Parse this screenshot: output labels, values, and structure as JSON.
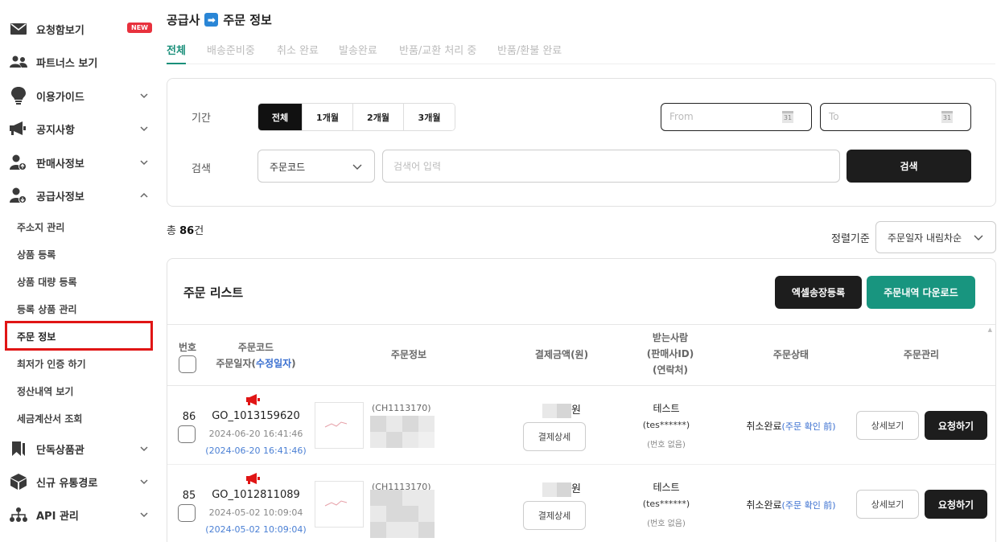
{
  "sidebar": {
    "items": [
      {
        "label": "요청함보기",
        "icon": "envelope-icon",
        "badge": "NEW"
      },
      {
        "label": "파트너스 보기",
        "icon": "users-icon"
      },
      {
        "label": "이용가이드",
        "icon": "lightbulb-icon"
      },
      {
        "label": "공지사항",
        "icon": "megaphone-icon"
      },
      {
        "label": "판매사정보",
        "icon": "user-upload-icon"
      },
      {
        "label": "공급사정보",
        "icon": "user-download-icon"
      },
      {
        "label": "단독상품관",
        "icon": "bookmark-icon"
      },
      {
        "label": "신규 유통경로",
        "icon": "box-icon"
      },
      {
        "label": "API 관리",
        "icon": "network-icon"
      }
    ],
    "sub_items": [
      "주소지 관리",
      "상품 등록",
      "상품 대량 등록",
      "등록 상품 관리",
      "주문 정보",
      "최저가 인증 하기",
      "정산내역 보기",
      "세금계산서 조회"
    ]
  },
  "header": {
    "title_prefix": "공급사",
    "title_arrow": "➡",
    "title_main": "주문 정보",
    "tabs": [
      "전체",
      "배송준비중",
      "취소 완료",
      "발송완료",
      "반품/교환 처리 중",
      "반품/환불 완료"
    ]
  },
  "filter": {
    "period_label": "기간",
    "periods": [
      "전체",
      "1개월",
      "2개월",
      "3개월"
    ],
    "from_placeholder": "From",
    "to_placeholder": "To",
    "calendar_day": "31",
    "search_label": "검색",
    "search_type": "주문코드",
    "search_placeholder": "검색어 입력",
    "search_button": "검색"
  },
  "summary": {
    "total_prefix": "총",
    "total_count": "86",
    "total_suffix": "건",
    "sort_label": "정렬기준",
    "sort_value": "주문일자 내림차순"
  },
  "list": {
    "title": "주문 리스트",
    "excel_button": "엑셀송장등록",
    "download_button": "주문내역 다운로드",
    "headers": {
      "num": "번호",
      "code_1": "주문코드",
      "code_2": "주문일자(",
      "code_link": "수정일자",
      "code_3": ")",
      "info": "주문정보",
      "price": "결제금액(원)",
      "receiver_1": "받는사람",
      "receiver_2": "(판매사ID)",
      "receiver_3": "(연락처)",
      "status": "주문상태",
      "manage": "주문관리"
    },
    "rows": [
      {
        "num": "86",
        "code": "GO_1013159620",
        "date": "2024-06-20 16:41:46",
        "modified": "(2024-06-20 16:41:46)",
        "product_code": "(CH1113170)",
        "price_unit": "원",
        "pay_button": "결제상세",
        "receiver": "테스트",
        "seller_id": "(tes******)",
        "phone": "(번호 없음)",
        "status": "취소완료",
        "status_link": "(주문 확인 前)",
        "detail_button": "상세보기",
        "request_button": "요청하기"
      },
      {
        "num": "85",
        "code": "GO_1012811089",
        "date": "2024-05-02 10:09:04",
        "modified": "(2024-05-02 10:09:04)",
        "product_code": "(CH1113170)",
        "price_unit": "원",
        "pay_button": "결제상세",
        "receiver": "테스트",
        "seller_id": "(tes******)",
        "phone": "(번호 없음)",
        "status": "취소완료",
        "status_link": "(주문 확인 前)",
        "detail_button": "상세보기",
        "request_button": "요청하기"
      }
    ]
  },
  "colors": {
    "accent": "#18957f",
    "dark": "#1d1d1d",
    "link": "#3a6fd0",
    "alert": "#e01515"
  }
}
